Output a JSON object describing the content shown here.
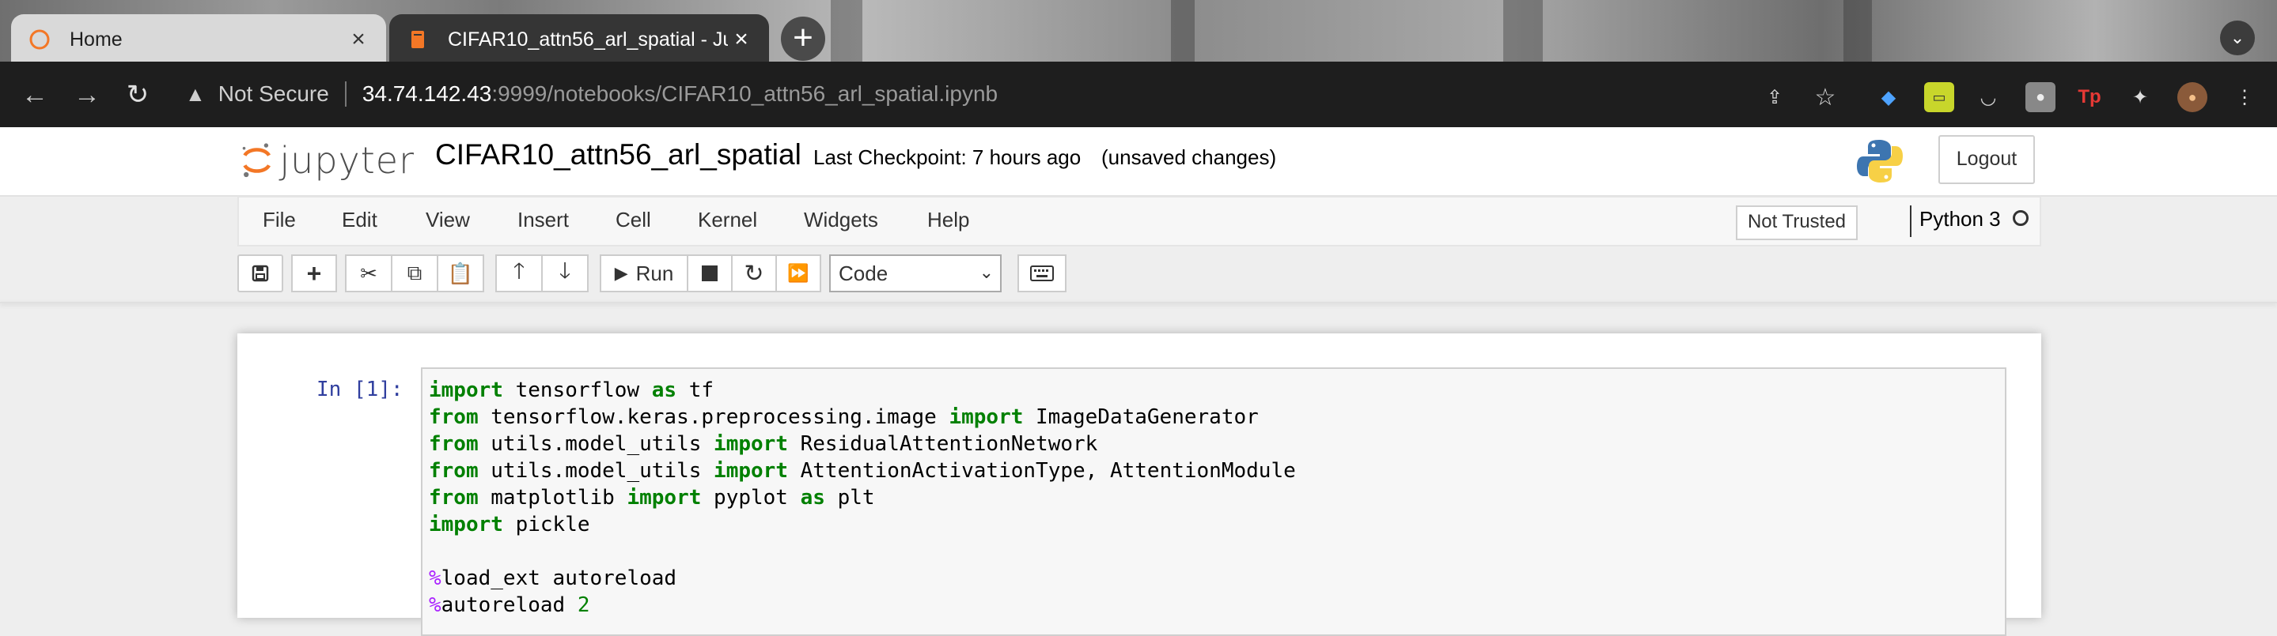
{
  "browser": {
    "tabs": [
      {
        "title": "Home",
        "active": false
      },
      {
        "title": "CIFAR10_attn56_arl_spatial - Jupyter",
        "active": true
      }
    ],
    "new_tab_label": "+",
    "address": {
      "security_label": "Not Secure",
      "host": "34.74.142.43",
      "path": ":9999/notebooks/CIFAR10_attn56_arl_spatial.ipynb"
    }
  },
  "jupyter": {
    "logo_text": "jupyter",
    "notebook_name": "CIFAR10_attn56_arl_spatial",
    "checkpoint": "Last Checkpoint: 7 hours ago",
    "unsaved": "(unsaved changes)",
    "logout_label": "Logout",
    "menu": [
      "File",
      "Edit",
      "View",
      "Insert",
      "Cell",
      "Kernel",
      "Widgets",
      "Help"
    ],
    "trust_label": "Not Trusted",
    "kernel_name": "Python 3",
    "toolbar": {
      "run_label": "Run",
      "cell_type": "Code"
    },
    "cell": {
      "prompt": "In [1]:",
      "lines": [
        [
          {
            "t": "import",
            "c": "kw"
          },
          {
            "t": " tensorflow "
          },
          {
            "t": "as",
            "c": "kw"
          },
          {
            "t": " tf"
          }
        ],
        [
          {
            "t": "from",
            "c": "kw"
          },
          {
            "t": " tensorflow.keras.preprocessing.image "
          },
          {
            "t": "import",
            "c": "kw"
          },
          {
            "t": " ImageDataGenerator"
          }
        ],
        [
          {
            "t": "from",
            "c": "kw"
          },
          {
            "t": " utils.model_utils "
          },
          {
            "t": "import",
            "c": "kw"
          },
          {
            "t": " ResidualAttentionNetwork"
          }
        ],
        [
          {
            "t": "from",
            "c": "kw"
          },
          {
            "t": " utils.model_utils "
          },
          {
            "t": "import",
            "c": "kw"
          },
          {
            "t": " AttentionActivationType, AttentionModule"
          }
        ],
        [
          {
            "t": "from",
            "c": "kw"
          },
          {
            "t": " matplotlib "
          },
          {
            "t": "import",
            "c": "kw"
          },
          {
            "t": " pyplot "
          },
          {
            "t": "as",
            "c": "kw"
          },
          {
            "t": " plt"
          }
        ],
        [
          {
            "t": "import",
            "c": "kw"
          },
          {
            "t": " pickle"
          }
        ],
        [],
        [
          {
            "t": "%",
            "c": "mg"
          },
          {
            "t": "load_ext autoreload"
          }
        ],
        [
          {
            "t": "%",
            "c": "mg"
          },
          {
            "t": "autoreload "
          },
          {
            "t": "2",
            "c": "num"
          }
        ]
      ]
    }
  },
  "colors": {
    "prompt": "#303f9f",
    "keyword": "#008000",
    "magic": "#aa22ff",
    "jupyter_orange": "#f37726"
  }
}
